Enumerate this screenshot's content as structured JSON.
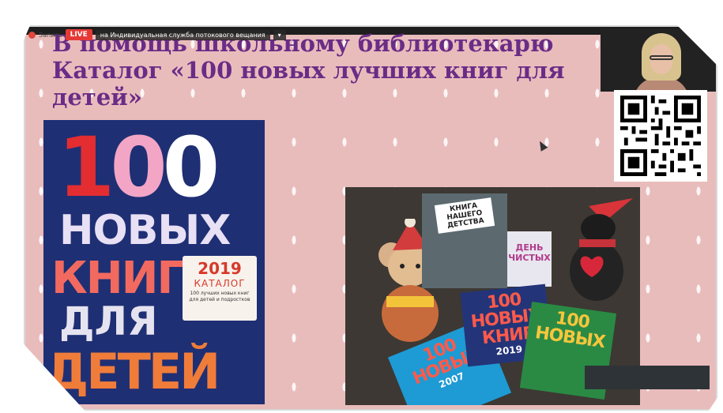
{
  "recording": {
    "label": "Запись",
    "live_badge": "LIVE",
    "stream_service": "на Индивидуальная служба потокового вещания"
  },
  "slide": {
    "heading_lines": [
      "В помощь школьному библиотекарю",
      "Каталог «100 новых лучших книг для",
      "детей»"
    ],
    "background_color": "#e9bcbc",
    "heading_color": "#6a2c86"
  },
  "catalog_cover": {
    "digits": [
      "1",
      "0",
      "0"
    ],
    "words": [
      "НОВЫХ",
      "КНИГ",
      "ДЛЯ",
      "ДЕТЕЙ"
    ],
    "sticker_year": "2019",
    "sticker_title": "КАТАЛОГ",
    "sticker_subtitle": "100 лучших новых книг для детей и подростков"
  },
  "books_photo": {
    "childhood_book_title": "КНИГА НАШЕГО ДЕТСТВА",
    "small_book_title": "ДЕНЬ ЧИСТЫХ",
    "catalog_a_label": "100 НОВЫХ КНИГ",
    "catalog_a_year": "2019",
    "catalog_b_label": "100 НОВЫХ",
    "catalog_c_label": "100 НОВЫХ",
    "catalog_c_year": "2007"
  },
  "icons": {
    "record": "record-dot-icon",
    "cursor": "mouse-cursor-icon",
    "qr": "qr-code-icon"
  }
}
